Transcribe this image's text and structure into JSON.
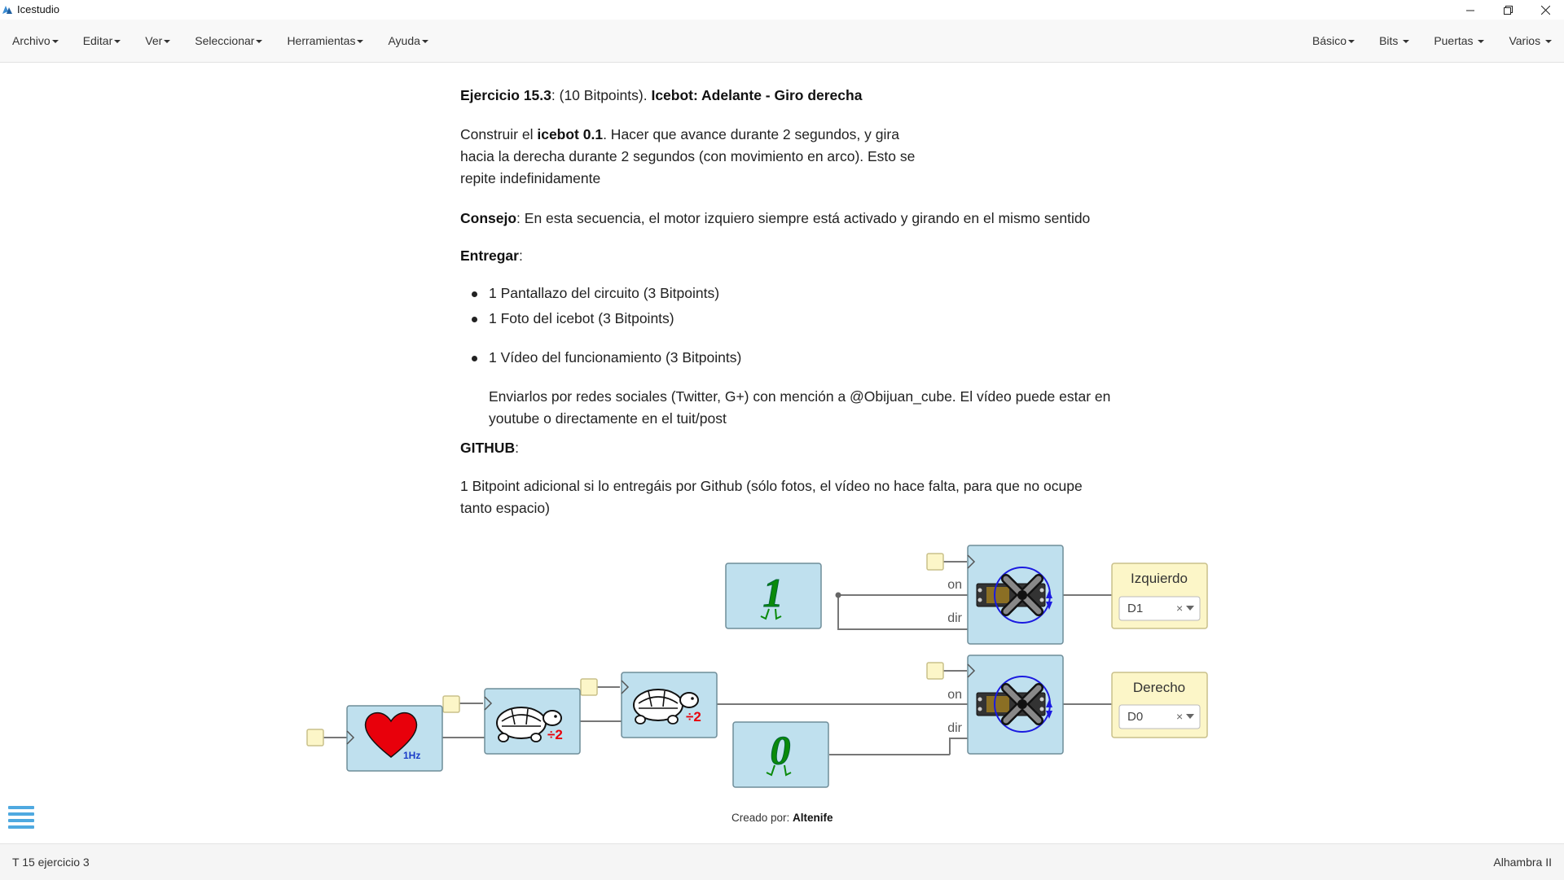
{
  "window": {
    "title": "Icestudio"
  },
  "menu": {
    "left": [
      "Archivo",
      "Editar",
      "Ver",
      "Seleccionar",
      "Herramientas",
      "Ayuda"
    ],
    "right": [
      "Básico",
      "Bits",
      "Puertas",
      "Varios"
    ]
  },
  "content": {
    "exercise_label": "Ejercicio 15.3",
    "exercise_points": ": (10 Bitpoints). ",
    "exercise_title": "Icebot: Adelante - Giro derecha",
    "build_pre": "Construir el ",
    "build_bold": "icebot 0.1",
    "build_post": ". Hacer que avance durante 2 segundos, y gira hacia la derecha durante 2 segundos (con movimiento en arco). Esto se repite indefinidamente",
    "tip_label": "Consejo",
    "tip_text": ": En esta secuencia, el motor izquiero siempre está activado y girando en el mismo sentido",
    "deliver_label": "Entregar",
    "deliver_colon": ":",
    "bullets": [
      "1 Pantallazo del circuito (3 Bitpoints)",
      "1 Foto del icebot (3 Bitpoints)",
      "1 Vídeo del funcionamiento (3 Bitpoints)"
    ],
    "send_text": "Enviarlos por redes sociales (Twitter, G+) con mención a @Obijuan_cube. El vídeo puede estar en youtube o directamente en el tuit/post",
    "github_label": "GITHUB",
    "github_colon": ":",
    "extra_text": "1 Bitpoint adicional si lo entregáis por Github (sólo fotos, el vídeo no hace falta, para que no ocupe tanto espacio)"
  },
  "circuit": {
    "heart_freq": "1Hz",
    "divider_label": "÷2",
    "const_one": "1",
    "const_zero": "0",
    "port_on": "on",
    "port_dir": "dir",
    "out_left_name": "Izquierdo",
    "out_left_pin": "D1",
    "out_right_name": "Derecho",
    "out_right_pin": "D0",
    "clear_glyph": "×",
    "credit_prefix": "Creado por: ",
    "credit_author": "Altenife"
  },
  "status": {
    "left": "T 15 ejercicio 3",
    "right": "Alhambra II"
  },
  "colors": {
    "block_fill": "#bfe0ee",
    "block_stroke": "#6f8d99",
    "wire": "#777777",
    "io_fill": "#fcf6c8",
    "io_stroke": "#c9c08a",
    "accent": "#4fa9e0",
    "const_green": "#0a8a0a"
  }
}
